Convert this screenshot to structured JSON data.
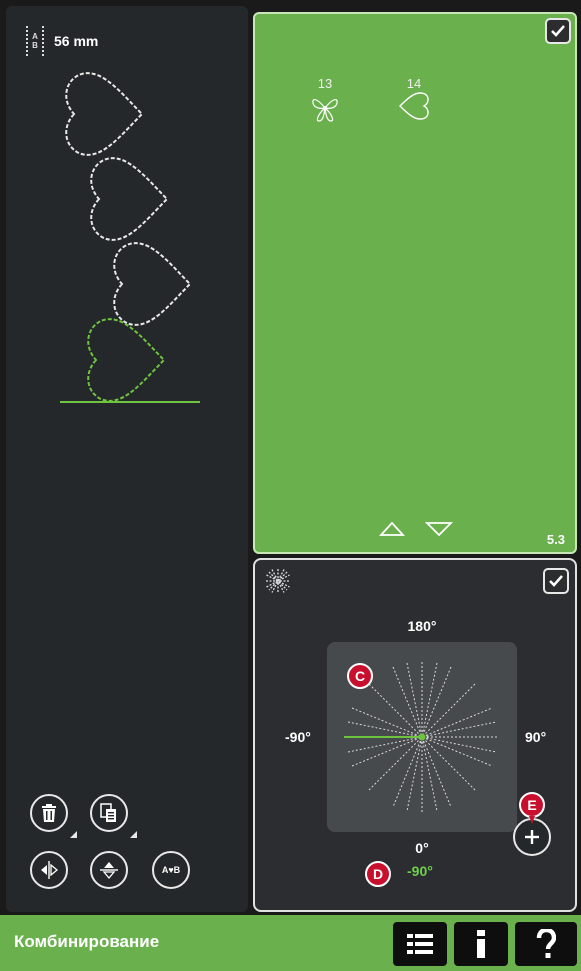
{
  "sequence": {
    "length_value": "56 mm",
    "length_icon": "abc-length-icon"
  },
  "tools": {
    "delete_icon": "trash-icon",
    "duplicate_icon": "duplicate-icon",
    "mirror_side_icon": "mirror-side-icon",
    "mirror_end_icon": "mirror-end-icon",
    "sequence_icon": "sequence-icon"
  },
  "stitch_menu": {
    "stitches": [
      {
        "number": "13",
        "icon": "butterfly-stitch-icon"
      },
      {
        "number": "14",
        "icon": "heart-stitch-icon"
      }
    ],
    "page": "5.3"
  },
  "angle": {
    "label_top": "180°",
    "label_left": "-90°",
    "label_right": "90°",
    "label_bottom": "0°",
    "current_value": "-90°",
    "callout_c": "C",
    "callout_d": "D",
    "callout_e": "E"
  },
  "bottom_bar": {
    "title": "Комбинирование"
  },
  "colors": {
    "accent_green": "#6ab04c",
    "callout_red": "#c8102e",
    "value_green": "#6ed04a"
  }
}
